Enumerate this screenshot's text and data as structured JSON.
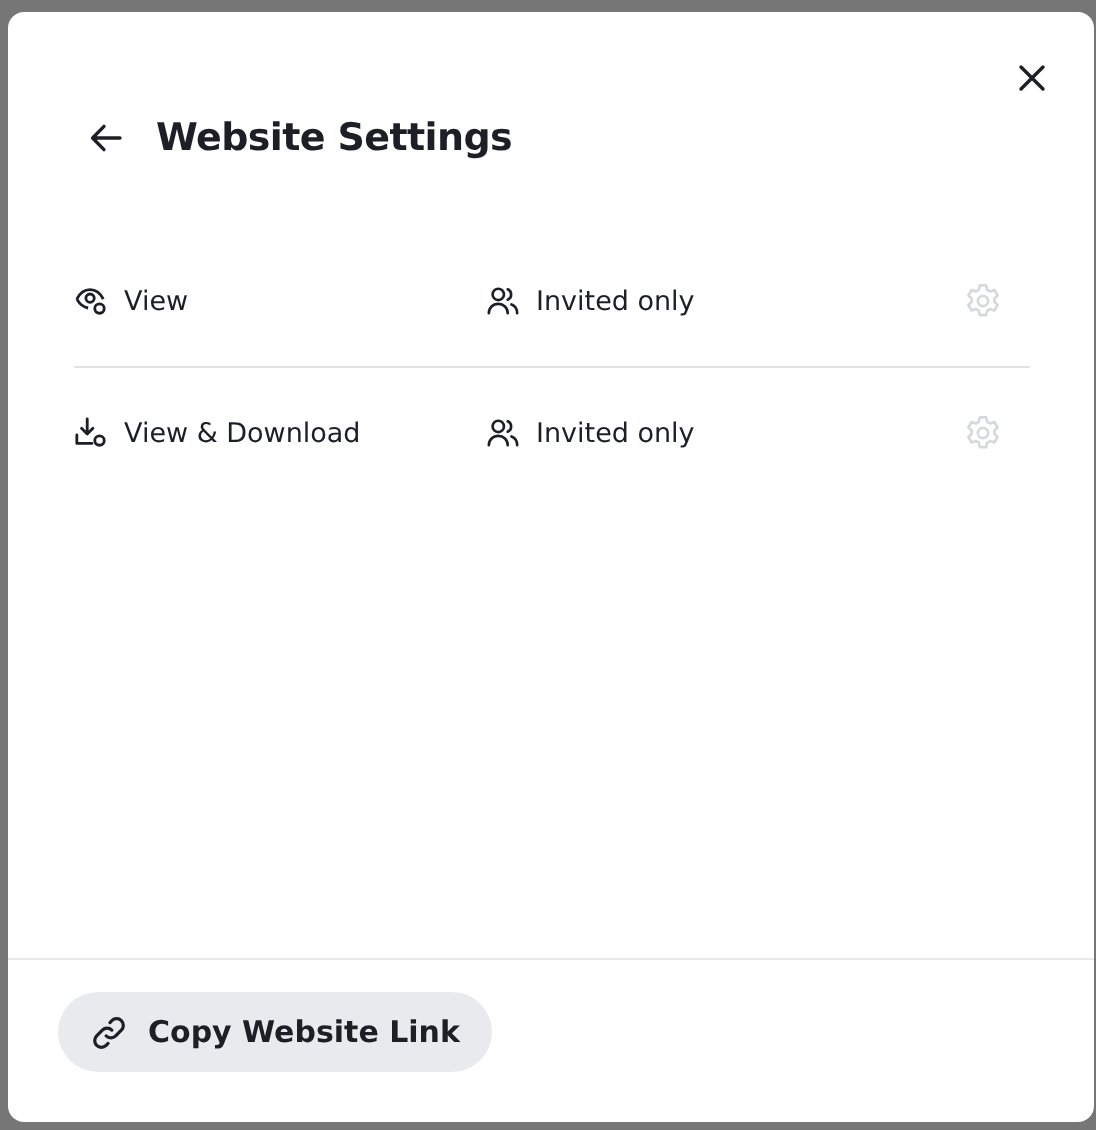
{
  "dialog": {
    "title": "Website Settings"
  },
  "permissions": [
    {
      "kind": "view",
      "label": "View",
      "audience": "Invited only",
      "settings_disabled": true
    },
    {
      "kind": "download",
      "label": "View & Download",
      "audience": "Invited only",
      "settings_disabled": true
    }
  ],
  "footer": {
    "button": "Copy Website Link"
  }
}
